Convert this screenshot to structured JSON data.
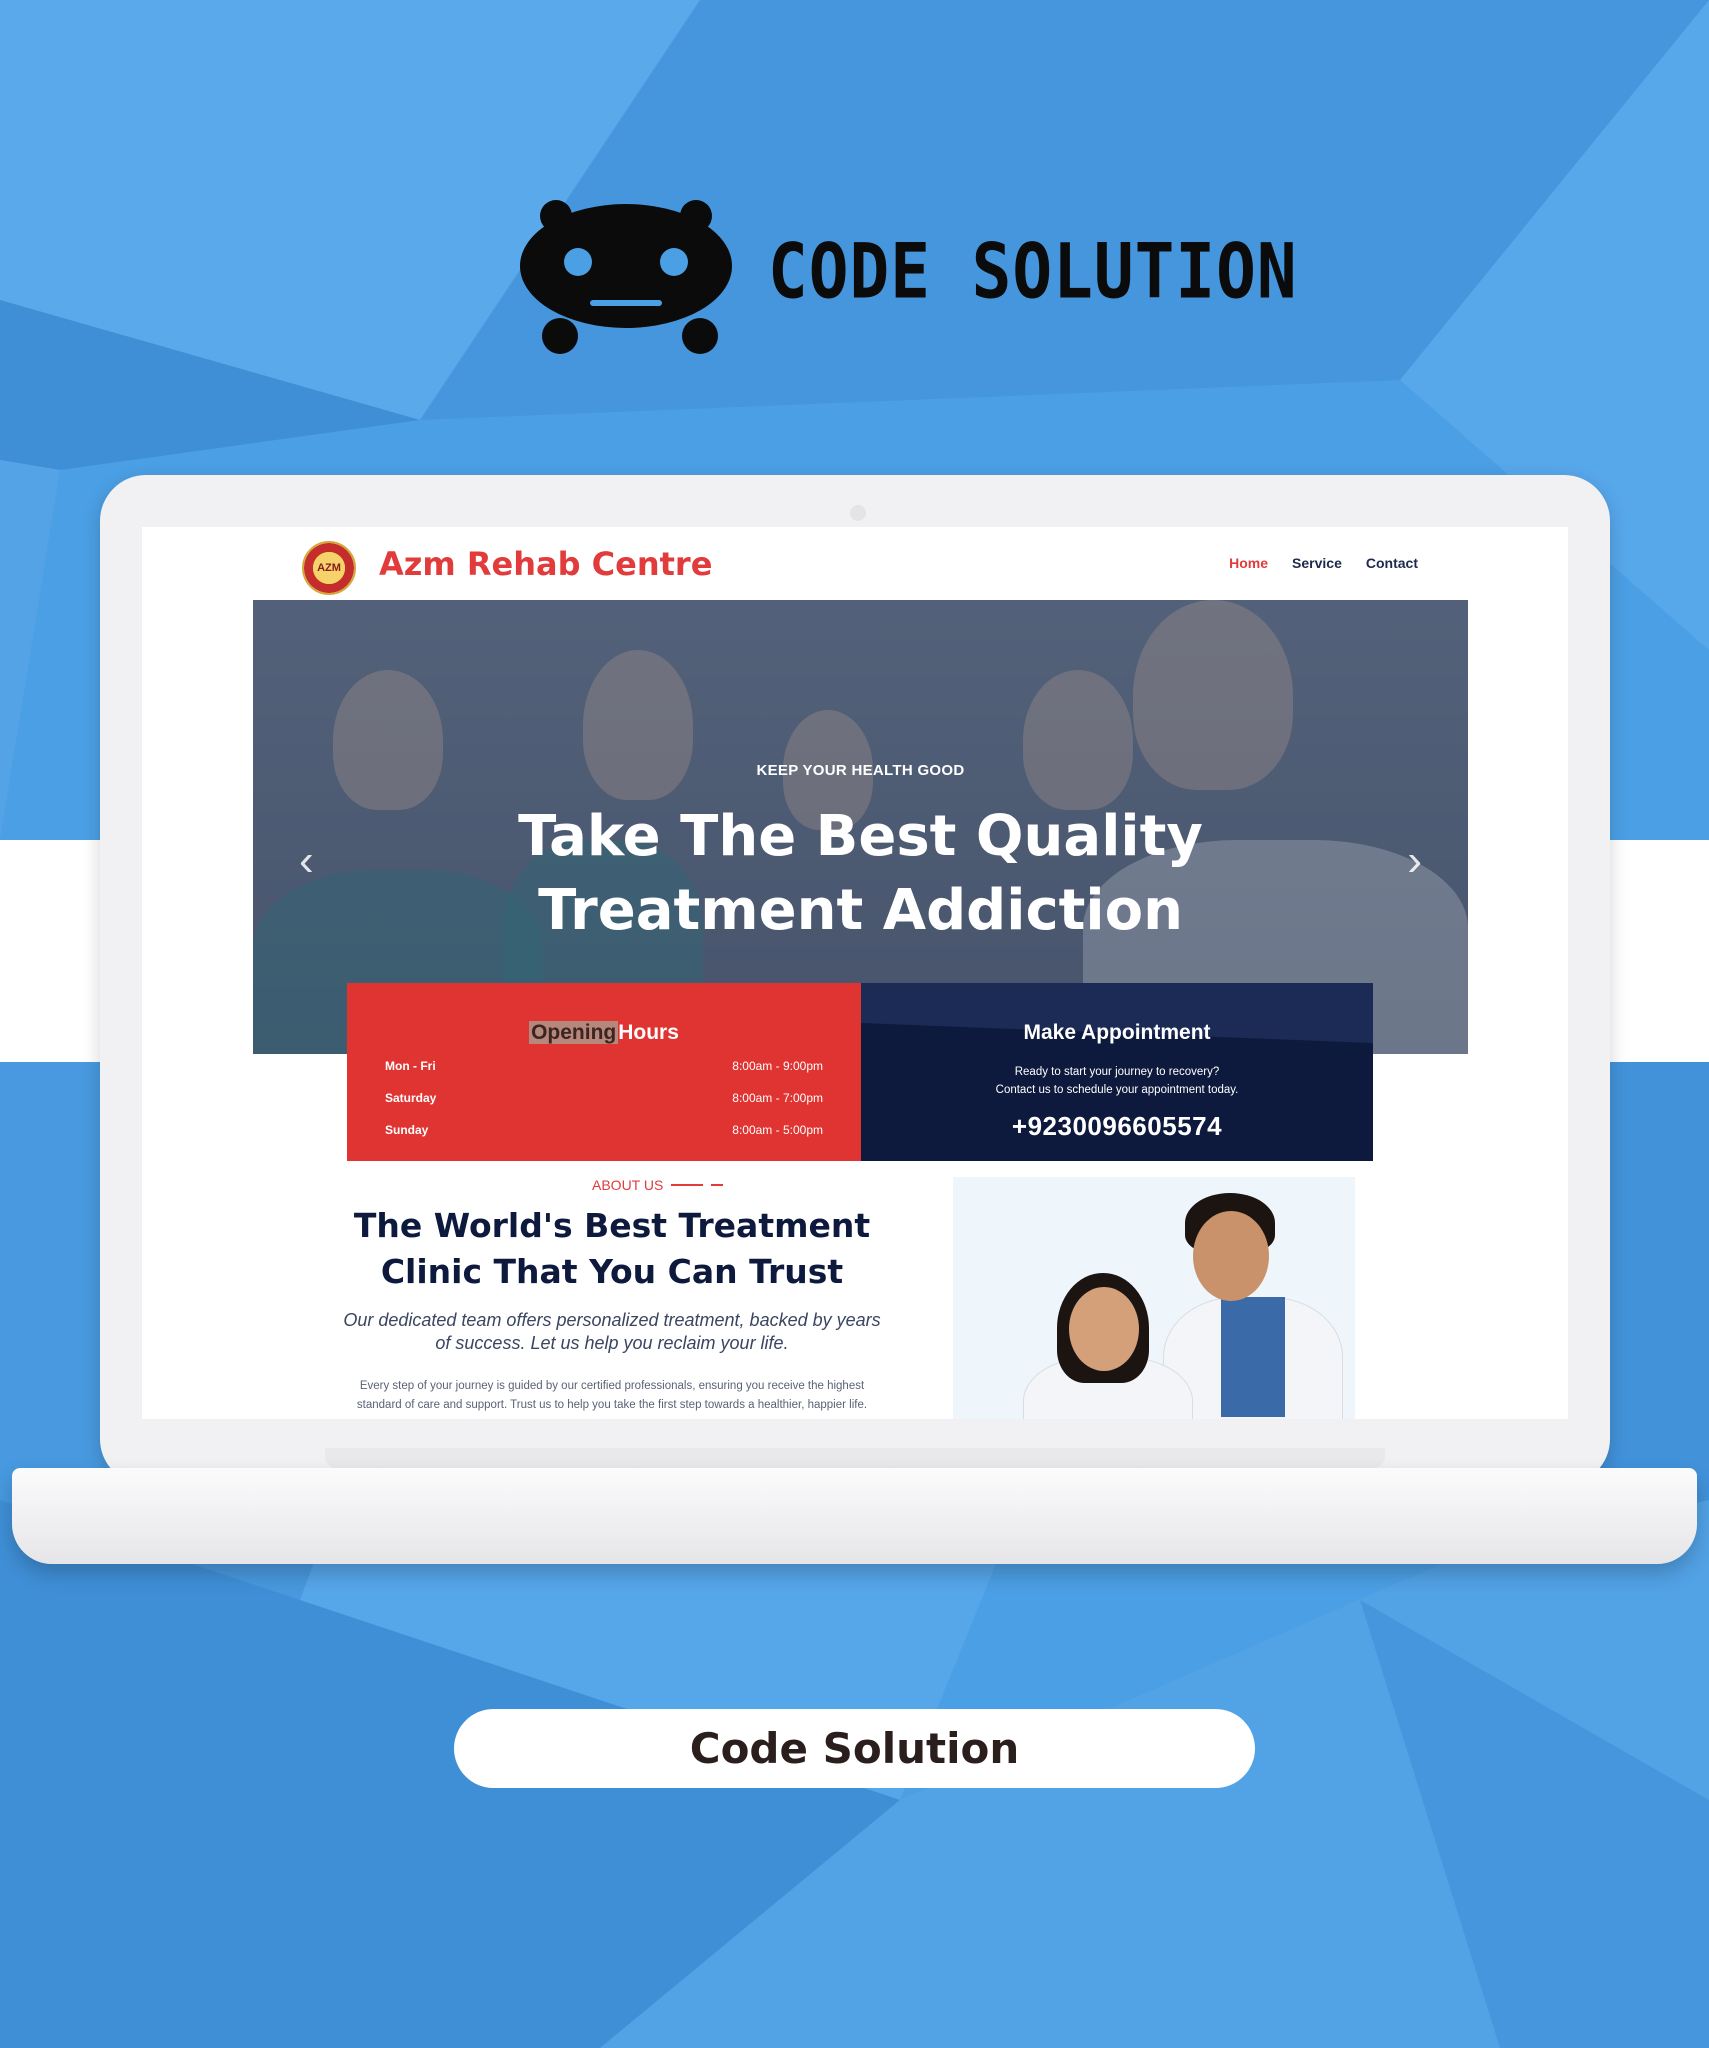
{
  "brand": {
    "name": "CODE SOLUTION",
    "icon": "robot-mascot-icon"
  },
  "website": {
    "site_name": "Azm Rehab Centre",
    "logo_text": "AZM",
    "nav": {
      "items": [
        "Home",
        "Service",
        "Contact"
      ],
      "active": "Home"
    },
    "hero": {
      "subtitle": "KEEP YOUR HEALTH GOOD",
      "title_line1": "Take The Best Quality",
      "title_line2": "Treatment Addiction"
    },
    "opening_hours": {
      "title_highlight": "Opening",
      "title_rest": "Hours",
      "rows": [
        {
          "day": "Mon - Fri",
          "time": "8:00am - 9:00pm"
        },
        {
          "day": "Saturday",
          "time": "8:00am - 7:00pm"
        },
        {
          "day": "Sunday",
          "time": "8:00am - 5:00pm"
        }
      ]
    },
    "appointment": {
      "title": "Make Appointment",
      "text_line1": "Ready to start your journey to recovery?",
      "text_line2": "Contact us to schedule your appointment today.",
      "phone": "+9230096605574"
    },
    "about": {
      "label": "ABOUT US",
      "title_line1": "The World's Best Treatment",
      "title_line2": "Clinic That You Can Trust",
      "lead_line1": "Our dedicated team offers personalized treatment, backed by years",
      "lead_line2": "of success. Let us help you reclaim your life.",
      "body_line1": "Every step of your journey is guided by our certified professionals, ensuring you receive the highest",
      "body_line2": "standard of care and support. Trust us to help you take the first step towards a healthier, happier life."
    }
  },
  "footer_pill": {
    "label": "Code Solution"
  },
  "colors": {
    "accent_red": "#e23b3b",
    "navy": "#0d1a3d",
    "background_blue": "#4a9ee3"
  }
}
